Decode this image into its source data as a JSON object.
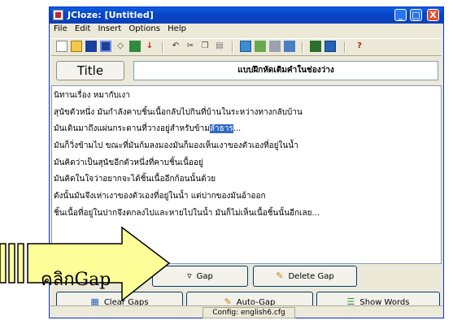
{
  "window": {
    "title": "JCloze: [Untitled]",
    "min": "_",
    "max": "□",
    "close": "X"
  },
  "menu": [
    "File",
    "Edit",
    "Insert",
    "Options",
    "Help"
  ],
  "toolbar_icons": [
    "new-icon",
    "open-icon",
    "save-icon",
    "save-as-icon",
    "erase-icon",
    "export-icon",
    "down-icon",
    "undo-icon",
    "cut-icon",
    "copy-icon",
    "paste-icon",
    "gap-list-icon",
    "image-icon",
    "table-icon",
    "web-icon",
    "view-icon",
    "config-icon",
    "help-icon"
  ],
  "title_button": "Title",
  "title_value": "แบบฝึกหัดเติมคำในช่องว่าง",
  "text_lines": [
    {
      "before": "นิทานเรื่อง หมากับเงา",
      "hl": "",
      "after": ""
    },
    {
      "before": "สุนัขตัวหนึ่ง มันกำลังคาบชิ้นเนื้อกลับไปกินที่บ้านในระหว่างทางกลับบ้าน",
      "hl": "",
      "after": ""
    },
    {
      "before": "มันเดินมาถึงแผ่นกระดานที่วางอยู่สำหรับข้าม",
      "hl": "ลำธาร",
      "after": "..."
    },
    {
      "before": "มันก็วิ่งข้ามไป ขณะที่มันก้มลงมองมันก็มองเห็นเงาของตัวเองที่อยู่ในน้ำ",
      "hl": "",
      "after": ""
    },
    {
      "before": "มันคิดว่าเป็นสุนัขอีกตัวหนึ่งที่คาบชิ้นเนื้ออยู่",
      "hl": "",
      "after": ""
    },
    {
      "before": "มันคิดในใจว่าอยากจะได้ชิ้นเนื้ออีกก้อนนั้นด้วย",
      "hl": "",
      "after": ""
    },
    {
      "before": "ดังนั้นมันจึงเห่าเงาของตัวเองที่อยู่ในน้ำ แต่ปากของมันอ้าออก",
      "hl": "",
      "after": ""
    },
    {
      "before": "ชิ้นเนื้อที่อยู่ในปากจึงตกลงไปและหายไปในน้ำ มันก็ไม่เห็นเนื้อชิ้นนั้นอีกเลย...",
      "hl": "",
      "after": ""
    }
  ],
  "buttons": {
    "gap": "Gap",
    "delete_gap": "Delete Gap",
    "clear_gaps": "Clear Gaps",
    "auto_gap": "Auto-Gap",
    "show_words": "Show Words"
  },
  "status": "Config: english6.cfg",
  "callout": {
    "label": "คลิกGap",
    "color": "#ffff99"
  }
}
